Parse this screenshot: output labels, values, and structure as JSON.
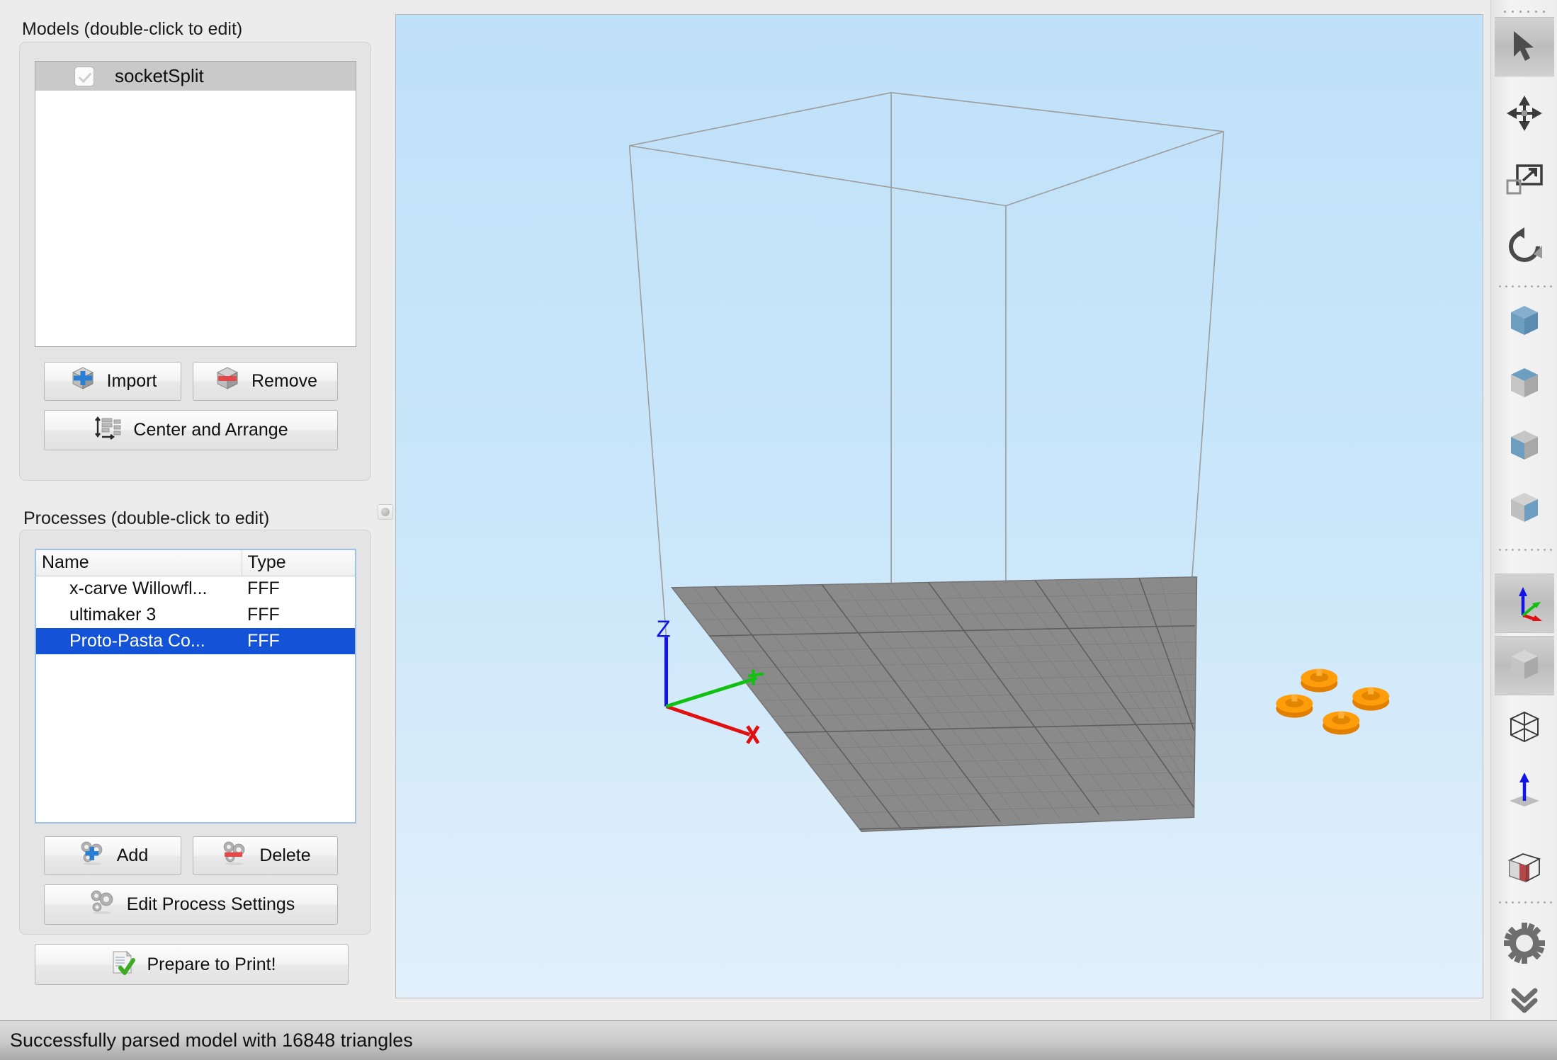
{
  "models": {
    "label": "Models (double-click to edit)",
    "items": [
      {
        "name": "socketSplit",
        "checked": true
      }
    ],
    "buttons": {
      "import": "Import",
      "remove": "Remove",
      "center_arrange": "Center and Arrange"
    }
  },
  "processes": {
    "label": "Processes (double-click to edit)",
    "columns": [
      "Name",
      "Type"
    ],
    "rows": [
      {
        "name": "x-carve Willowfl...",
        "type": "FFF",
        "selected": false
      },
      {
        "name": "ultimaker 3",
        "type": "FFF",
        "selected": false
      },
      {
        "name": "Proto-Pasta Co...",
        "type": "FFF",
        "selected": true
      }
    ],
    "buttons": {
      "add": "Add",
      "delete": "Delete",
      "edit_process_settings": "Edit Process Settings",
      "prepare_to_print": "Prepare to Print!"
    }
  },
  "viewport": {
    "axis_labels": {
      "z": "Z",
      "x": "X"
    },
    "model_count": 4,
    "colors": {
      "background_top": "#bfe1f9",
      "background_bottom": "#e3f0fb",
      "build_plate": "#8a8a8a",
      "model_orange": "#ff9d0a",
      "axis_z": "#1414e6",
      "axis_x": "#e01010",
      "axis_y": "#12c012",
      "build_volume_wire": "#9a9a9a"
    }
  },
  "toolbar": {
    "items": [
      {
        "icon": "cursor-select-icon",
        "active": true
      },
      {
        "icon": "move-icon",
        "active": false
      },
      {
        "icon": "scale-icon",
        "active": false
      },
      {
        "icon": "rotate-icon",
        "active": false
      },
      {
        "icon": "cube-all-faces-icon",
        "active": false
      },
      {
        "icon": "cube-top-face-icon",
        "active": false
      },
      {
        "icon": "cube-left-face-icon",
        "active": false
      },
      {
        "icon": "cube-right-face-icon",
        "active": false
      },
      {
        "icon": "axis-indicator-icon",
        "active": true
      },
      {
        "icon": "cube-solid-icon",
        "active": true
      },
      {
        "icon": "cube-wireframe-icon",
        "active": false
      },
      {
        "icon": "surface-normal-icon",
        "active": false
      },
      {
        "icon": "cross-section-icon",
        "active": false
      },
      {
        "icon": "gear-settings-icon",
        "active": false
      },
      {
        "icon": "double-chevron-down-icon",
        "active": false
      }
    ]
  },
  "status": {
    "message": "Successfully parsed model with 16848 triangles"
  }
}
